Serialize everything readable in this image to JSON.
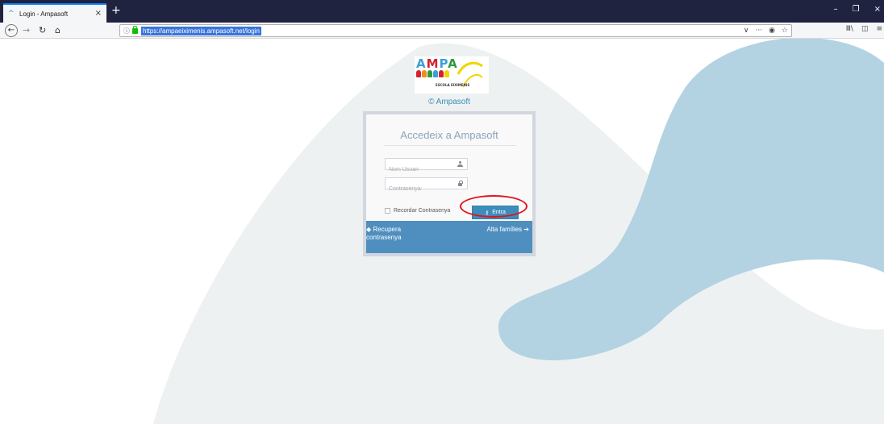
{
  "browser": {
    "tab": {
      "title": "Login - Ampasoft",
      "close": "×",
      "favicon": "ampa-caret-icon"
    },
    "new_tab": "+",
    "window_controls": {
      "minimize": "–",
      "restore": "❐",
      "close": "×"
    },
    "nav": {
      "back": "←",
      "forward": "→",
      "reload": "↻",
      "home": "⌂"
    },
    "url": "https://ampaeiximenis.ampasoft.net/login",
    "url_actions": {
      "dropdown": "∨",
      "more": "···",
      "pocket": "◉",
      "bookmark": "☆"
    },
    "tools": {
      "library": "Ⅲ\\",
      "sidebar": "◫",
      "menu": "≡"
    }
  },
  "page": {
    "logo": {
      "word": [
        "A",
        "M",
        "P",
        "A"
      ],
      "caption": "ESCOLA EIXIMENIS"
    },
    "copyright": "© Ampasoft",
    "login": {
      "title": "Accedeix a Ampasoft",
      "username_placeholder": "Nom Usuari",
      "password_placeholder": "Contrasenya:",
      "remember_label": "Recordar Contrasenya",
      "enter_label": "Entra",
      "recover_link": "Recupera contrasenya",
      "register_link": "Alta famílies"
    }
  },
  "colors": {
    "accent": "#3c8dbc",
    "footer": "#4f8fc0",
    "highlight": "#e0141c",
    "bg_shape_light": "#eef1f1",
    "bg_shape_blue": "#b3d2e2"
  }
}
